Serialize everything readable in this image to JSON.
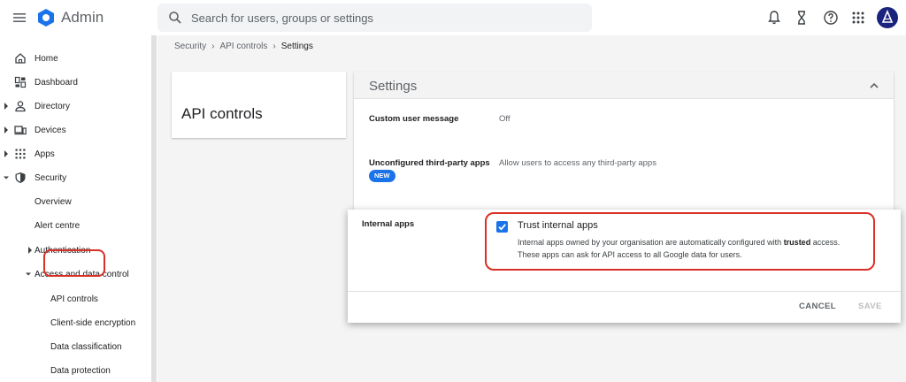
{
  "app": {
    "title": "Admin"
  },
  "search": {
    "placeholder": "Search for users, groups or settings"
  },
  "topbar_icons": [
    "bell-icon",
    "hourglass-icon",
    "help-icon",
    "apps-grid-icon",
    "account-avatar"
  ],
  "sidebar": {
    "items": [
      {
        "label": "Home",
        "icon": "home-icon"
      },
      {
        "label": "Dashboard",
        "icon": "dashboard-icon"
      },
      {
        "label": "Directory",
        "icon": "person-icon"
      },
      {
        "label": "Devices",
        "icon": "devices-icon"
      },
      {
        "label": "Apps",
        "icon": "apps-grid-icon"
      },
      {
        "label": "Security",
        "icon": "shield-icon"
      },
      {
        "label": "Overview"
      },
      {
        "label": "Alert centre"
      },
      {
        "label": "Authentication"
      },
      {
        "label": "Access and data control"
      },
      {
        "label": "API controls"
      },
      {
        "label": "Client-side encryption"
      },
      {
        "label": "Data classification"
      },
      {
        "label": "Data protection"
      }
    ]
  },
  "breadcrumb": {
    "items": [
      "Security",
      "API controls",
      "Settings"
    ]
  },
  "page": {
    "title": "API controls"
  },
  "settings": {
    "title": "Settings",
    "rows": [
      {
        "label": "Custom user message",
        "value": "Off"
      },
      {
        "label": "Unconfigured third-party apps",
        "value": "Allow users to access any third-party apps",
        "badge": "NEW"
      }
    ]
  },
  "dialog": {
    "label": "Internal apps",
    "checkbox_title": "Trust internal apps",
    "desc_line1_a": "Internal apps owned by your organisation are automatically configured with ",
    "desc_line1_bold": "trusted",
    "desc_line1_b": " access.",
    "desc_line2": "These apps can ask for API access to all Google data for users.",
    "cancel": "CANCEL",
    "save": "SAVE"
  },
  "colors": {
    "accent": "#1a73e8",
    "highlight": "#d93025",
    "avatar": "#1a237e"
  }
}
